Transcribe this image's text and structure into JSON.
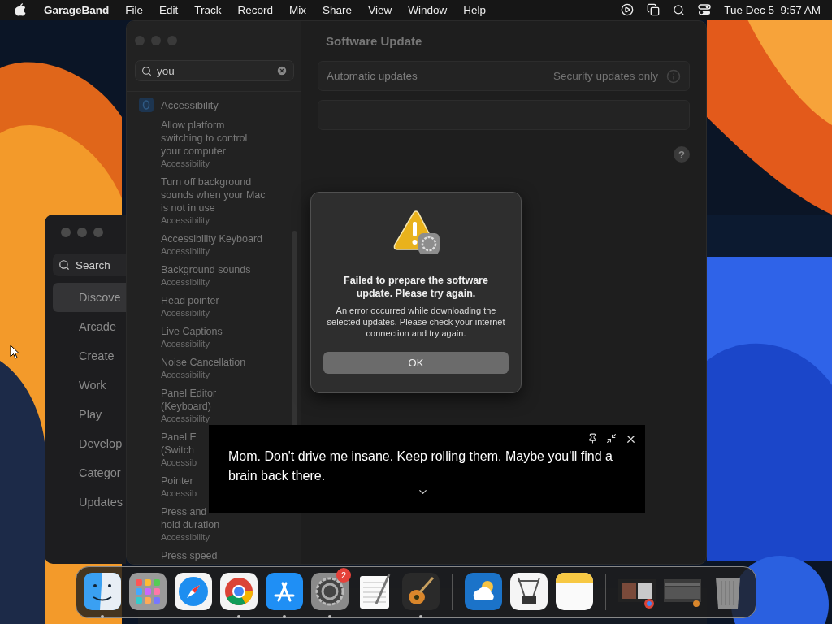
{
  "menubar": {
    "app": "GarageBand",
    "menus": [
      "File",
      "Edit",
      "Track",
      "Record",
      "Mix",
      "Share",
      "View",
      "Window",
      "Help"
    ],
    "clock": "Tue Dec 5  9:57 AM"
  },
  "app_store_window": {
    "search": {
      "placeholder": "Search"
    },
    "items": [
      {
        "label": "Discove",
        "selected": true
      },
      {
        "label": "Arcade",
        "selected": false
      },
      {
        "label": "Create",
        "selected": false
      },
      {
        "label": "Work",
        "selected": false
      },
      {
        "label": "Play",
        "selected": false
      },
      {
        "label": "Develop",
        "selected": false
      },
      {
        "label": "Categor",
        "selected": false
      },
      {
        "label": "Updates",
        "selected": false
      }
    ]
  },
  "settings_window": {
    "search": {
      "value": "you"
    },
    "results": [
      {
        "kind": "category",
        "title": "Accessibility"
      },
      {
        "kind": "result",
        "title": "Allow platform\nswitching to control\nyour computer",
        "subtitle": "Accessibility"
      },
      {
        "kind": "result",
        "title": "Turn off background\nsounds when your Mac\nis not in use",
        "subtitle": "Accessibility"
      },
      {
        "kind": "result",
        "title": "Accessibility Keyboard",
        "subtitle": "Accessibility"
      },
      {
        "kind": "result",
        "title": "Background sounds",
        "subtitle": "Accessibility"
      },
      {
        "kind": "result",
        "title": "Head pointer",
        "subtitle": "Accessibility"
      },
      {
        "kind": "result",
        "title": "Live Captions",
        "subtitle": "Accessibility"
      },
      {
        "kind": "result",
        "title": "Noise Cancellation",
        "subtitle": "Accessibility"
      },
      {
        "kind": "result",
        "title": "Panel Editor\n(Keyboard)",
        "subtitle": "Accessibility"
      },
      {
        "kind": "result",
        "title": "Panel E\n(Switch",
        "subtitle": "Accessib"
      },
      {
        "kind": "result",
        "title": "Pointer",
        "subtitle": "Accessib"
      },
      {
        "kind": "result",
        "title": "Press and\nhold duration",
        "subtitle": "Accessibility"
      },
      {
        "kind": "result",
        "title": "Press speed"
      }
    ],
    "title": "Software Update",
    "rows": [
      {
        "label": "Automatic updates",
        "value": "Security updates only"
      }
    ],
    "help": "?"
  },
  "alert": {
    "title": "Failed to prepare the software update. Please try again.",
    "message": "An error occurred while downloading the selected updates. Please check your internet connection and try again.",
    "button": "OK"
  },
  "captions": {
    "text": "Mom. Don't drive me insane. Keep rolling them. Maybe you'll find a brain back there."
  },
  "dock": [
    {
      "kind": "finder",
      "running": true
    },
    {
      "kind": "launchpad",
      "running": false
    },
    {
      "kind": "safari",
      "running": false
    },
    {
      "kind": "chrome",
      "running": true
    },
    {
      "kind": "appstore",
      "running": true
    },
    {
      "kind": "settings",
      "running": true,
      "badge": "2"
    },
    {
      "kind": "textedit",
      "running": false
    },
    {
      "kind": "garageband",
      "running": true
    },
    {
      "kind": "separator"
    },
    {
      "kind": "weather",
      "running": false
    },
    {
      "kind": "sysinfo",
      "running": false
    },
    {
      "kind": "notes",
      "running": false
    },
    {
      "kind": "separator"
    },
    {
      "kind": "window-thumb",
      "running": false
    },
    {
      "kind": "window-thumb-2",
      "running": false
    },
    {
      "kind": "trash",
      "running": false
    }
  ]
}
